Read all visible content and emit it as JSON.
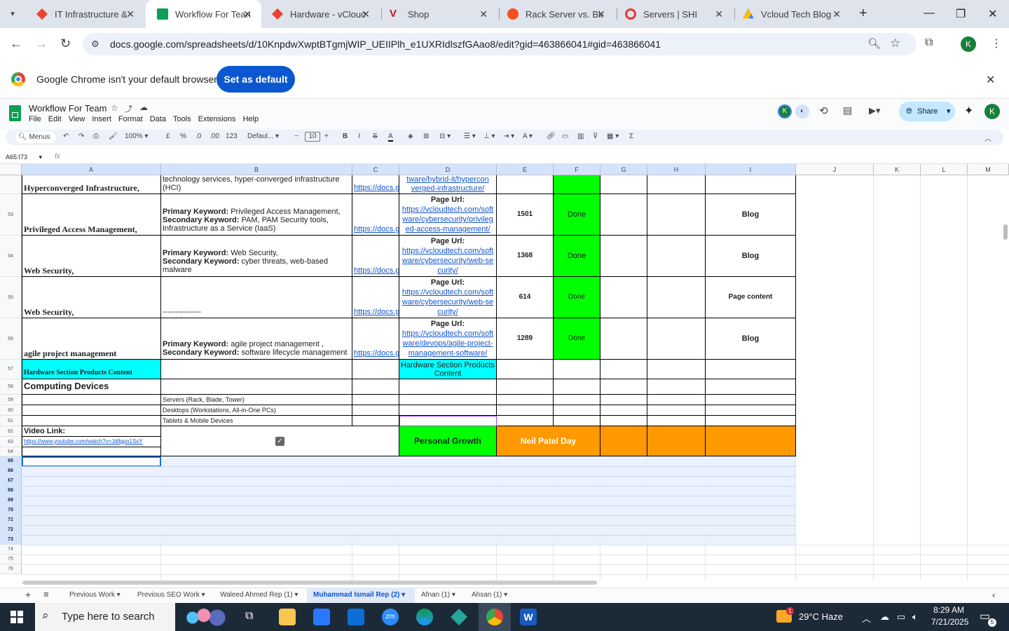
{
  "browser": {
    "tabs": [
      {
        "title": "IT Infrastructure &",
        "color": "#ea4335"
      },
      {
        "title": "Workflow For Tean",
        "color": "#0f9d58"
      },
      {
        "title": "Hardware - vClouc",
        "color": "#ea4335"
      },
      {
        "title": "Shop",
        "color": "#b71c1c"
      },
      {
        "title": "Rack Server vs. Bla",
        "color": "#f4511e"
      },
      {
        "title": "Servers | SHI",
        "color": "#e53935"
      },
      {
        "title": "Vcloud Tech Blog",
        "color": "#fbbc04"
      }
    ],
    "url": "docs.google.com/spreadsheets/d/10KnpdwXwptBTgmjWIP_UEIIPlh_e1UXRIdlszfGAao8/edit?gid=463866041#gid=463866041",
    "infobar_text": "Google Chrome isn't your default browser",
    "set_default_label": "Set as default",
    "profile_initial": "K"
  },
  "sheets": {
    "doc_title": "Workflow For Team",
    "menu": [
      "File",
      "Edit",
      "View",
      "Insert",
      "Format",
      "Data",
      "Tools",
      "Extensions",
      "Help"
    ],
    "share_label": "Share",
    "toolbar": {
      "menus": "Menus",
      "zoom": "100%",
      "currency": "£",
      "percent": "%",
      "dec_less": ".0",
      "dec_more": ".00",
      "num": "123",
      "font": "Defaul...",
      "font_size": "10"
    },
    "name_box": "A65:I73",
    "fx": "fx",
    "columns": [
      "A",
      "B",
      "C",
      "D",
      "E",
      "F",
      "G",
      "H",
      "I",
      "J",
      "K",
      "L",
      "M"
    ],
    "rows": {
      "r52": {
        "a": "Hyperconverged Infrastructure,",
        "b": "technology services, hyper-converged infrastructure (HCI)",
        "c": "https://docs.g",
        "d": "tware/hybrid-it/hypercon verged-infrastructure/"
      },
      "r53": {
        "num": "53",
        "a": "Privileged Access Management,",
        "b1": "Primary Keyword:",
        "b1v": " Privileged Access Management,",
        "b2": "Secondary Keyword:",
        "b2v": " PAM, PAM Security tools, Infrastructure as a Service (IaaS)",
        "c": "https://docs.g",
        "d_head": "Page Url:",
        "d": "https://vcloudtech.com/software/cybersecurity/privileged-access-management/",
        "e": "1501",
        "f": "Done",
        "i": "Blog"
      },
      "r54": {
        "num": "54",
        "a": "Web Security,",
        "b1": "Primary Keyword:",
        "b1v": " Web Security,",
        "b2": "Secondary Keyword:",
        "b2v": " cyber threats, web-based malware",
        "c": "https://docs.g",
        "d_head": "Page Url:",
        "d": "https://vcloudtech.com/software/cybersecurity/web-security/",
        "e": "1368",
        "f": "Done",
        "i": "Blog"
      },
      "r55": {
        "num": "55",
        "a": "Web Security,",
        "b": "---------------",
        "c": "https://docs.g",
        "d_head": "Page Url:",
        "d": "https://vcloudtech.com/software/cybersecurity/web-security/",
        "e": "614",
        "f": "Done",
        "i": "Page content"
      },
      "r56": {
        "num": "56",
        "a": "agile project management",
        "b1": "Primary Keyword:",
        "b1v": "  agile project management ,",
        "b2": "Secondary Keyword:",
        "b2v": "  software lifecycle management",
        "c": "https://docs.g",
        "d_head": "Page Url:",
        "d": "https://vcloudtech.com/software/devops/agile-project-management-software/",
        "e": "1289",
        "f": "Done",
        "i": "Blog"
      },
      "r57": {
        "num": "57",
        "a": "Hardware Section Products Content",
        "d": "Hardware Section Products Content"
      },
      "r58": {
        "num": "58",
        "a": "Computing Devices"
      },
      "r59": {
        "num": "59",
        "b": "Servers (Rack, Blade, Tower)"
      },
      "r60": {
        "num": "60",
        "b": "Desktops (Workstations, All-in-One PCs)"
      },
      "r61": {
        "num": "61",
        "b": "Tablets & Mobile Devices"
      },
      "r62": {
        "num": "62",
        "a": "Video Link:",
        "d": "Personal Growth",
        "e": "Neil Patel Day"
      },
      "r63": {
        "num": "63",
        "a": "https://www.youtube.com/watch?v=Jdllgpo1SsY"
      },
      "r64": {
        "num": "64"
      }
    },
    "extra_rows": [
      "65",
      "66",
      "67",
      "68",
      "69",
      "70",
      "71",
      "72",
      "73",
      "74",
      "75",
      "76"
    ],
    "sheet_tabs": [
      "Previous Work",
      "Previous SEO Work",
      "Waleed Ahmed Rep (1)",
      "Muhammad Ismail Rep (2)",
      "Afnan (1)",
      "Ahsan (1)"
    ],
    "active_sheet": "Muhammad Ismail Rep (2)"
  },
  "taskbar": {
    "search_placeholder": "Type here to search",
    "weather": "29°C  Haze",
    "time": "8:29 AM",
    "date": "7/21/2025",
    "notif_badge": "1",
    "notif_count": "5"
  }
}
